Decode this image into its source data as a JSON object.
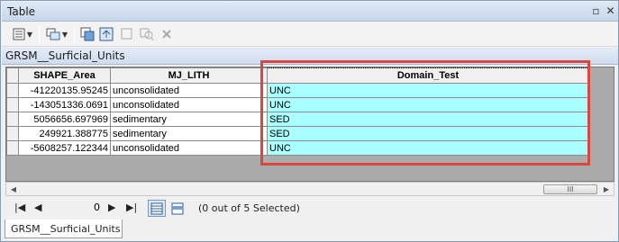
{
  "window": {
    "title": "Table"
  },
  "toolbar": {
    "icons": [
      "table-options-icon",
      "related-tables-icon",
      "select-by-attributes-icon",
      "switch-selection-icon",
      "clear-selection-icon",
      "zoom-to-selected-icon",
      "delete-selected-icon"
    ]
  },
  "table_tab": {
    "label": "GRSM__Surficial_Units"
  },
  "grid": {
    "columns": [
      "SHAPE_Area",
      "MJ_LITH",
      "Domain_Test"
    ],
    "rows": [
      [
        "-41220135.95245",
        "unconsolidated",
        "UNC"
      ],
      [
        "-143051336.0691",
        "unconsolidated",
        "UNC"
      ],
      [
        "5056656.697969",
        "sedimentary",
        "SED"
      ],
      [
        "249921.388775",
        "sedimentary",
        "SED"
      ],
      [
        "-5608257.122344",
        "unconsolidated",
        "UNC"
      ]
    ],
    "highlight_color": "#d9473f",
    "domain_cell_color": "#aaffff"
  },
  "scrollbar": {
    "thumb_glyph": "III"
  },
  "navigation": {
    "first": "|◀",
    "prev": "◀",
    "current_record": "0",
    "next": "▶",
    "last": "▶|",
    "status": "(0 out of 5 Selected)"
  },
  "bottom_tab": {
    "label": "GRSM__Surficial_Units"
  }
}
